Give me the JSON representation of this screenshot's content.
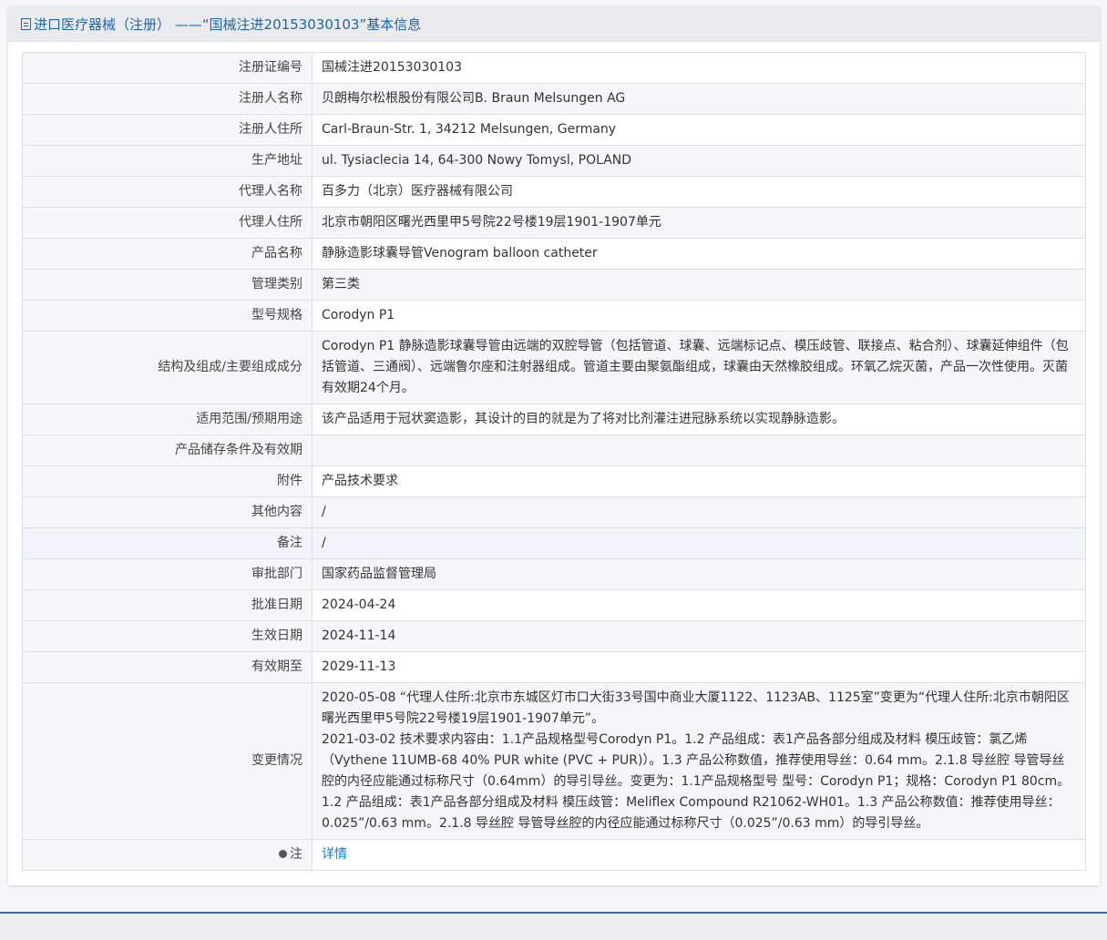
{
  "header": {
    "title": "进口医疗器械（注册） ——“国械注进20153030103”基本信息"
  },
  "rows": [
    {
      "label": "注册证编号",
      "value": "国械注进20153030103"
    },
    {
      "label": "注册人名称",
      "value": "贝朗梅尔松根股份有限公司B. Braun Melsungen AG"
    },
    {
      "label": "注册人住所",
      "value": "Carl-Braun-Str. 1, 34212 Melsungen, Germany"
    },
    {
      "label": "生产地址",
      "value": "ul. Tysiaclecia 14, 64-300 Nowy Tomysl, POLAND"
    },
    {
      "label": "代理人名称",
      "value": "百多力（北京）医疗器械有限公司"
    },
    {
      "label": "代理人住所",
      "value": "北京市朝阳区曙光西里甲5号院22号楼19层1901-1907单元"
    },
    {
      "label": "产品名称",
      "value": "静脉造影球囊导管Venogram balloon catheter"
    },
    {
      "label": "管理类别",
      "value": "第三类"
    },
    {
      "label": "型号规格",
      "value": "Corodyn P1"
    },
    {
      "label": "结构及组成/主要组成成分",
      "value": "Corodyn P1 静脉造影球囊导管由远端的双腔导管（包括管道、球囊、远端标记点、模压歧管、联接点、粘合剂）、球囊延伸组件（包括管道、三通阀）、远端鲁尔座和注射器组成。管道主要由聚氨酯组成，球囊由天然橡胶组成。环氧乙烷灭菌，产品一次性使用。灭菌有效期24个月。"
    },
    {
      "label": "适用范围/预期用途",
      "value": "该产品适用于冠状窦造影，其设计的目的就是为了将对比剂灌注进冠脉系统以实现静脉造影。"
    },
    {
      "label": "产品储存条件及有效期",
      "value": ""
    },
    {
      "label": "附件",
      "value": "产品技术要求"
    },
    {
      "label": "其他内容",
      "value": "/"
    },
    {
      "label": "备注",
      "value": "/"
    },
    {
      "label": "审批部门",
      "value": "国家药品监督管理局"
    },
    {
      "label": "批准日期",
      "value": "2024-04-24"
    },
    {
      "label": "生效日期",
      "value": "2024-11-14"
    },
    {
      "label": "有效期至",
      "value": "2029-11-13"
    }
  ],
  "changes": {
    "label": "变更情况",
    "entries": [
      "2020-05-08 “代理人住所:北京市东城区灯市口大街33号国中商业大厦1122、1123AB、1125室”变更为“代理人住所:北京市朝阳区曙光西里甲5号院22号楼19层1901-1907单元”。",
      "2021-03-02 技术要求内容由：1.1产品规格型号Corodyn P1。1.2 产品组成：表1产品各部分组成及材料 模压歧管：氯乙烯（Vythene 11UMB-68 40% PUR white (PVC + PUR)）。1.3 产品公称数值，推荐使用导丝：0.64 mm。2.1.8 导丝腔 导管导丝腔的内径应能通过标称尺寸（0.64mm）的导引导丝。变更为：1.1产品规格型号 型号：Corodyn P1；规格：Corodyn P1 80cm。1.2 产品组成：表1产品各部分组成及材料 模压歧管：Meliflex Compound R21062-WH01。1.3 产品公称数值：推荐使用导丝：0.025”/0.63 mm。2.1.8 导丝腔 导管导丝腔的内径应能通过标称尺寸（0.025”/0.63 mm）的导引导丝。"
    ]
  },
  "note": {
    "label": "注",
    "link": "详情"
  }
}
